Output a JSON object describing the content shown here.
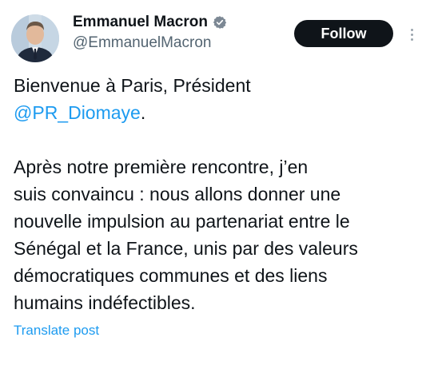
{
  "author": {
    "display_name": "Emmanuel Macron",
    "handle": "@EmmanuelMacron",
    "verified_icon": "verified-badge-icon",
    "avatar_icon": "profile-avatar"
  },
  "actions": {
    "follow_label": "Follow",
    "more_icon": "more-options-icon"
  },
  "tweet": {
    "line1": "Bienvenue à Paris, Président",
    "mention": "@PR_Diomaye",
    "mention_suffix": ".",
    "body_lines": [
      "Après notre première rencontre, j’en",
      "suis convaincu : nous allons donner une",
      "nouvelle impulsion au partenariat entre le",
      "Sénégal et la France, unis par des valeurs",
      "démocratiques communes et des liens",
      "humains indéfectibles."
    ]
  },
  "footer": {
    "translate_label": "Translate post"
  },
  "colors": {
    "link": "#1d9bf0",
    "text": "#0f1419",
    "secondary": "#536471",
    "button_bg": "#0f1419"
  }
}
